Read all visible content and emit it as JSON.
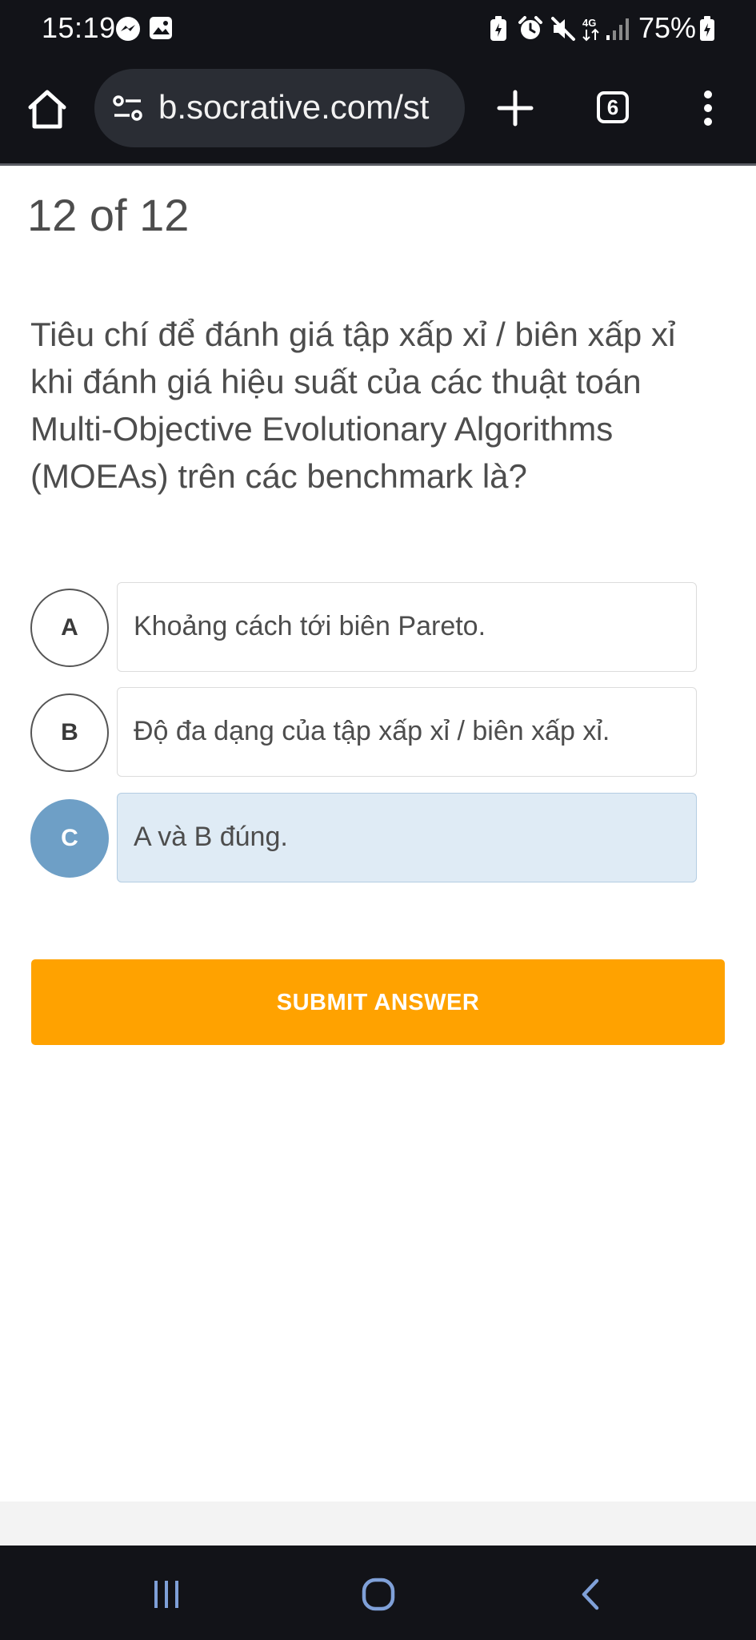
{
  "status_bar": {
    "time": "15:19",
    "network": "4G",
    "battery": "75%",
    "icons": [
      "messenger-icon",
      "gallery-icon",
      "battery-saver-icon",
      "alarm-icon",
      "mute-icon",
      "network-4g-icon",
      "signal-icon",
      "battery-icon"
    ]
  },
  "browser": {
    "url": "b.socrative.com/st",
    "tab_count": "6",
    "icons": [
      "home-icon",
      "site-settings-icon",
      "new-tab-icon",
      "tab-switcher-icon",
      "more-menu-icon"
    ]
  },
  "quiz": {
    "counter": "12 of 12",
    "question": "Tiêu chí để đánh giá tập xấp xỉ / biên xấp xỉ khi đánh giá hiệu suất của các thuật toán Multi-Objective Evolutionary Algorithms (MOEAs) trên các benchmark là?",
    "options": [
      {
        "letter": "A",
        "text": "Khoảng cách tới biên Pareto.",
        "selected": false
      },
      {
        "letter": "B",
        "text": "Độ đa dạng của tập xấp xỉ / biên xấp xỉ.",
        "selected": false
      },
      {
        "letter": "C",
        "text": "A và B đúng.",
        "selected": true
      }
    ],
    "submit_label": "SUBMIT ANSWER"
  },
  "colors": {
    "accent": "#ffa200",
    "selected_badge": "#6e9fc6",
    "selected_background": "#dfebf5",
    "text": "#4d4d4d",
    "system_bar": "#121318"
  },
  "nav_bar": {
    "icons": [
      "recent-apps-icon",
      "home-nav-icon",
      "back-icon"
    ]
  }
}
